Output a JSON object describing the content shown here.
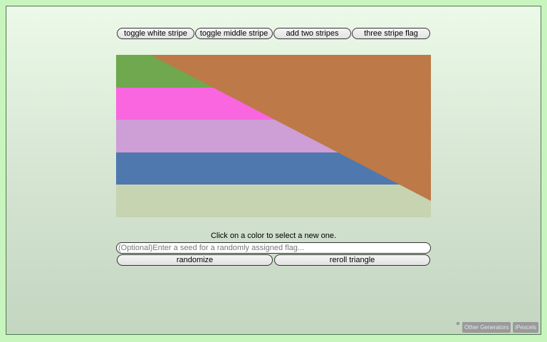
{
  "toolbar": {
    "toggle_white": "toggle white stripe",
    "toggle_middle": "toggle middle stripe",
    "add_two": "add two stripes",
    "three_stripe": "three stripe flag"
  },
  "flag": {
    "stripes": [
      "#6fa84e",
      "#f966e0",
      "#ce9ed6",
      "#4f78ae",
      "#c7d4b1"
    ],
    "triangle_color": "#bd7948"
  },
  "instructions": "Click on a color to select a new one.",
  "seed_input": {
    "placeholder": "(Optional)Enter a seed for a randomly assigned flag...",
    "value": ""
  },
  "actions": {
    "randomize": "randomize",
    "reroll": "reroll triangle"
  },
  "footer": {
    "other_generators": "Other Generators",
    "author": "iPexcels"
  }
}
